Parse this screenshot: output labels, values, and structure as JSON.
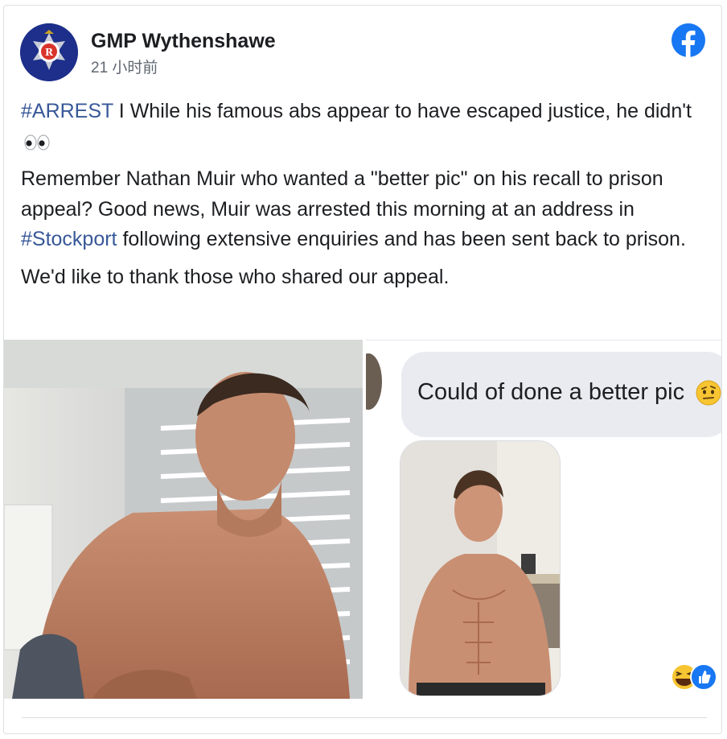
{
  "post": {
    "page_name": "GMP Wythenshawe",
    "timestamp": "21 小时前",
    "hashtag_arrest": "#ARREST",
    "line1_rest": " I While his famous abs appear to have escaped justice, he didn't",
    "para2_before": "Remember Nathan Muir who wanted a \"better pic\" on his recall to prison appeal? Good news, Muir was arrested this morning at an address in ",
    "hashtag_stockport": "#Stockport",
    "para2_after": " following extensive enquiries and has been sent back to prison.",
    "para3": "We'd like to thank those who shared our appeal."
  },
  "chat": {
    "message": "Could of done a better pic"
  },
  "icons": {
    "avatar": "police-badge-logo",
    "brand": "facebook-logo",
    "eyes": "eyes-emoji",
    "emoji_in_bubble": "raised-eyebrow-emoji",
    "reactions": [
      "haha-reaction",
      "like-reaction"
    ]
  },
  "colors": {
    "hashtag": "#385898",
    "facebook_blue": "#1877f2",
    "badge_navy": "#1d2f8a"
  }
}
